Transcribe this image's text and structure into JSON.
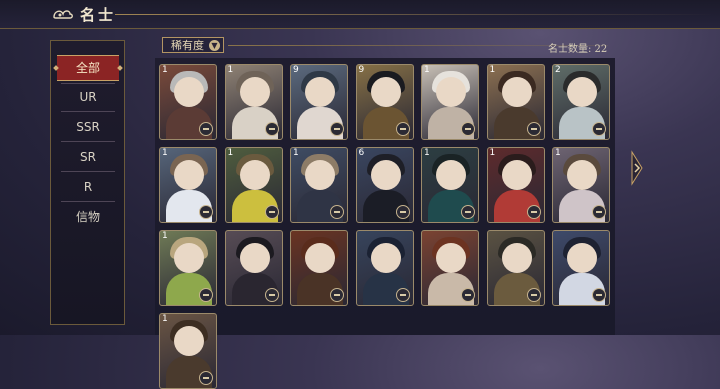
{
  "header": {
    "title": "名士"
  },
  "sidebar": {
    "items": [
      {
        "label": "全部",
        "active": true
      },
      {
        "label": "UR"
      },
      {
        "label": "SSR"
      },
      {
        "label": "SR"
      },
      {
        "label": "R"
      },
      {
        "label": "信物"
      }
    ]
  },
  "filter": {
    "label": "稀有度"
  },
  "summary": {
    "count_text": "名士数量: 22"
  },
  "cards": [
    {
      "num": "1",
      "bg": "#7a4a3a",
      "hair": "#b9b9b8",
      "body": "#5b3b35"
    },
    {
      "num": "1",
      "bg": "#8f8274",
      "hair": "#6f6358",
      "body": "#d9d1c6"
    },
    {
      "num": "9",
      "bg": "#5b6a7e",
      "hair": "#2f3946",
      "body": "#e0d7d0"
    },
    {
      "num": "9",
      "bg": "#867046",
      "hair": "#1a1b20",
      "body": "#6b5432"
    },
    {
      "num": "1",
      "bg": "#c8c0b6",
      "hair": "#e6e2dc",
      "body": "#bfb2a5"
    },
    {
      "num": "1",
      "bg": "#8c7051",
      "hair": "#3b2a21",
      "body": "#4a3a2d"
    },
    {
      "num": "2",
      "bg": "#5f6d68",
      "hair": "#2a2b2b",
      "body": "#b9c3c6"
    },
    {
      "num": "1",
      "bg": "#56657a",
      "hair": "#7a6552",
      "body": "#e3e7ee"
    },
    {
      "num": "1",
      "bg": "#4f5d3e",
      "hair": "#6a5a3e",
      "body": "#ccbf3e"
    },
    {
      "num": "1",
      "bg": "#3f4c63",
      "hair": "#8d7c67",
      "body": "#2f3445"
    },
    {
      "num": "6",
      "bg": "#3a4660",
      "hair": "#1e1f27",
      "body": "#1b1d26"
    },
    {
      "num": "1",
      "bg": "#2c3e42",
      "hair": "#1a2325",
      "body": "#1f4b4e"
    },
    {
      "num": "1",
      "bg": "#5e2b2c",
      "hair": "#2a1c1c",
      "body": "#b13b36"
    },
    {
      "num": "1",
      "bg": "#6e6472",
      "hair": "#5a4a3d",
      "body": "#cfc4c8"
    },
    {
      "num": "1",
      "bg": "#6f7a56",
      "hair": "#b9a67e",
      "body": "#8ea84c"
    },
    {
      "num": "",
      "bg": "#574c55",
      "hair": "#1c1a20",
      "body": "#2a2630"
    },
    {
      "num": "",
      "bg": "#6a3422",
      "hair": "#5a2c1c",
      "body": "#4a3326"
    },
    {
      "num": "",
      "bg": "#37445c",
      "hair": "#1b2233",
      "body": "#273346"
    },
    {
      "num": "",
      "bg": "#7b4332",
      "hair": "#6c3321",
      "body": "#c9b9a8"
    },
    {
      "num": "",
      "bg": "#5a5242",
      "hair": "#2b2a25",
      "body": "#6b5b3e"
    },
    {
      "num": "",
      "bg": "#3e4a6a",
      "hair": "#1e2232",
      "body": "#d2d7e3"
    },
    {
      "num": "1",
      "bg": "#6a5544",
      "hair": "#3d2e22",
      "body": "#4a3a2d"
    }
  ]
}
